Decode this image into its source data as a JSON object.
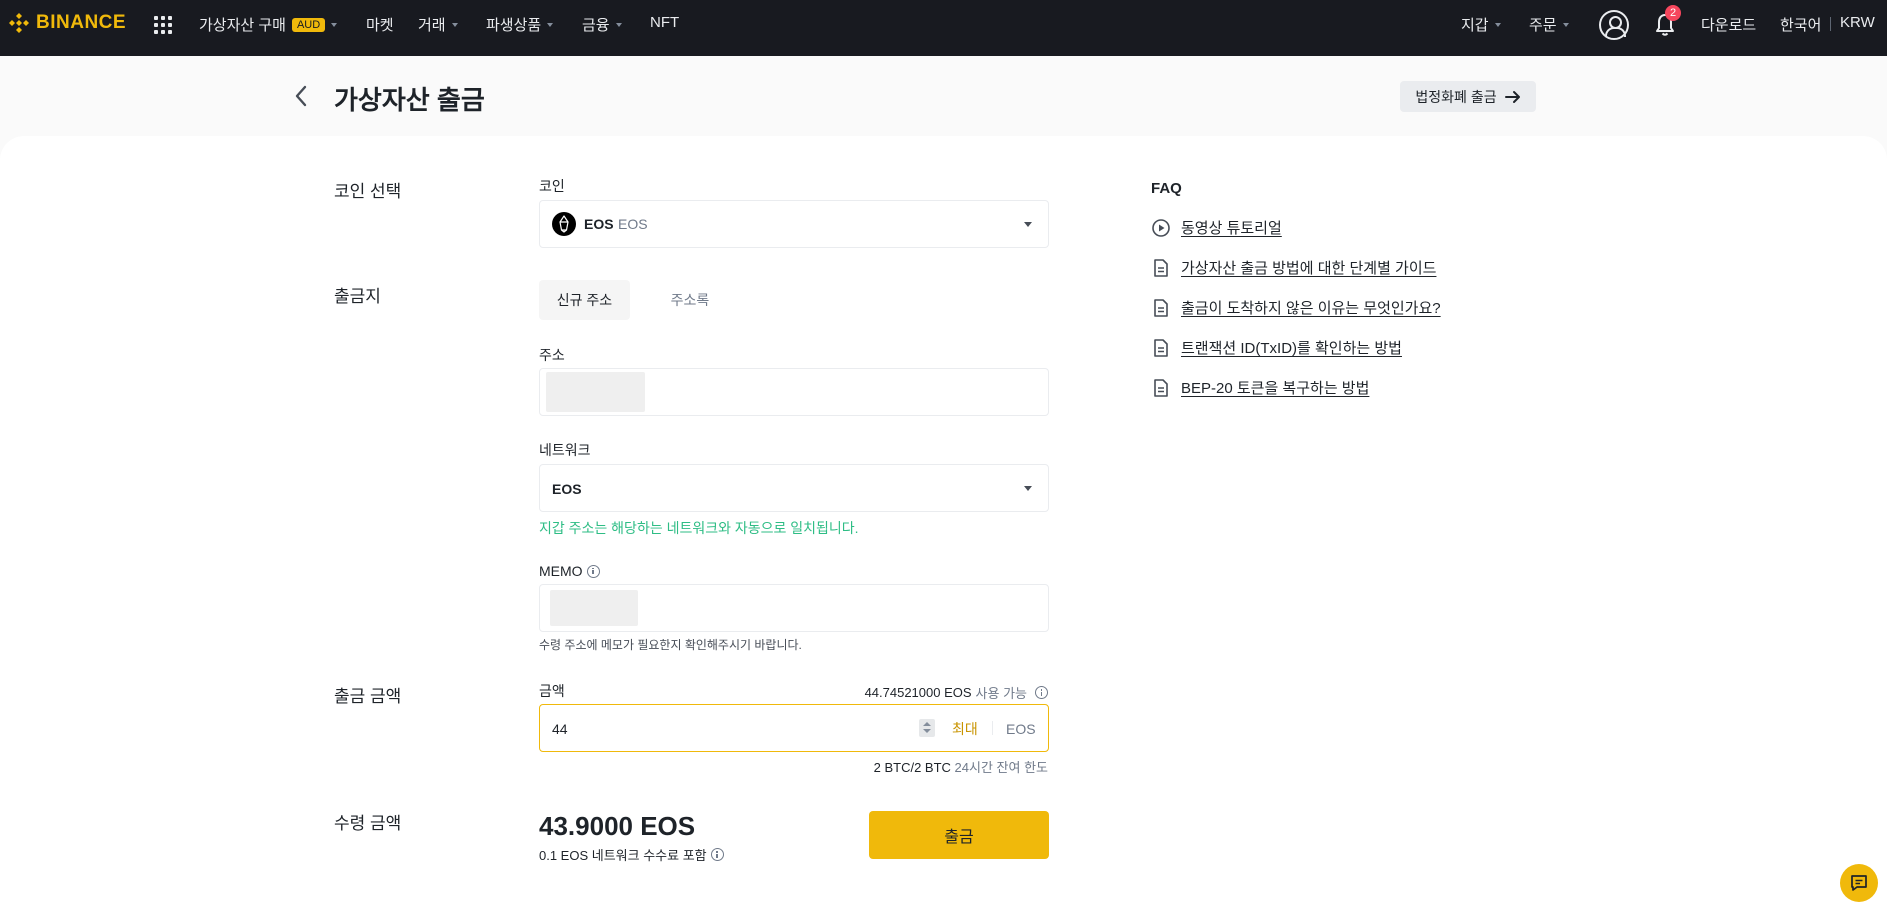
{
  "nav": {
    "logo": "BINANCE",
    "buy_crypto": "가상자산 구매",
    "buy_badge": "AUD",
    "markets": "마켓",
    "trade": "거래",
    "derivatives": "파생상품",
    "finance": "금융",
    "nft": "NFT",
    "wallet": "지갑",
    "orders": "주문",
    "notifications": "2",
    "download": "다운로드",
    "language": "한국어",
    "currency": "KRW"
  },
  "header": {
    "title": "가상자산 출금",
    "fiat_button": "법정화폐 출금"
  },
  "form": {
    "coin_section": "코인 선택",
    "coin_label": "코인",
    "coin_symbol": "EOS",
    "coin_name": "EOS",
    "destination_section": "출금지",
    "tab_new": "신규 주소",
    "tab_book": "주소록",
    "address_label": "주소",
    "network_label": "네트워크",
    "network_value": "EOS",
    "network_hint": "지갑 주소는 해당하는 네트워크와 자동으로 일치됩니다.",
    "memo_label": "MEMO",
    "memo_hint": "수령 주소에 메모가 필요한지 확인해주시기 바랍니다.",
    "amount_section": "출금 금액",
    "amount_label": "금액",
    "available_value": "44.74521000 EOS",
    "available_text": "사용 가능",
    "amount_value": "44",
    "max_label": "최대",
    "amount_unit": "EOS",
    "limit_value": "2 BTC/2 BTC",
    "limit_text": "24시간 잔여 한도",
    "receive_section": "수령 금액",
    "receive_value": "43.9000 EOS",
    "fee_note": "0.1 EOS 네트워크 수수료 포함",
    "withdraw_button": "출금"
  },
  "faq": {
    "title": "FAQ",
    "items": [
      {
        "label": "동영상 튜토리얼",
        "icon": "play-circle-icon"
      },
      {
        "label": "가상자산 출금 방법에 대한 단계별 가이드",
        "icon": "document-icon"
      },
      {
        "label": "출금이 도착하지 않은 이유는 무엇인가요?",
        "icon": "document-icon"
      },
      {
        "label": "트랜잭션 ID(TxID)를 확인하는 방법",
        "icon": "document-icon"
      },
      {
        "label": "BEP-20 토큰을 복구하는 방법",
        "icon": "document-icon"
      }
    ]
  },
  "colors": {
    "brand": "#f0b90b",
    "nav_bg": "#181a20",
    "success": "#2ebd85",
    "badge": "#f6465d"
  }
}
